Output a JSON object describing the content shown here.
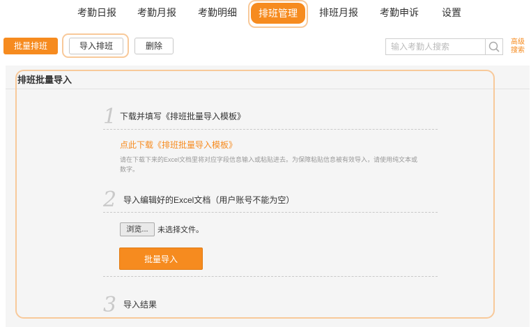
{
  "nav": {
    "tabs": [
      {
        "label": "考勤日报"
      },
      {
        "label": "考勤月报"
      },
      {
        "label": "考勤明细"
      },
      {
        "label": "排班管理"
      },
      {
        "label": "排班月报"
      },
      {
        "label": "考勤申诉"
      },
      {
        "label": "设置"
      }
    ]
  },
  "toolbar": {
    "batch_schedule": "批量排班",
    "import_schedule": "导入排班",
    "delete": "删除",
    "search_placeholder": "输入考勤人搜索",
    "advanced_search_line1": "高级",
    "advanced_search_line2": "搜索"
  },
  "panel": {
    "title": "排班批量导入",
    "steps": [
      {
        "num": "1",
        "title": "下载并填写《排班批量导入模板》"
      },
      {
        "num": "2",
        "title": "导入编辑好的Excel文档（用户账号不能为空）"
      },
      {
        "num": "3",
        "title": "导入结果"
      }
    ],
    "download_link": "点此下载《排班批量导入模板》",
    "hint_line1": "请在下载下来的Excel文档里将对应字段信息输入或粘贴进去。为保障粘贴信息被有效导入，请使用纯文本或",
    "hint_line2": "数字。",
    "browse_label": "浏览...",
    "file_status": "未选择文件。",
    "import_button": "批量导入"
  },
  "colors": {
    "accent": "#f68b1f",
    "highlight": "#f8c99a",
    "panel_bg": "#f5f5f5"
  }
}
